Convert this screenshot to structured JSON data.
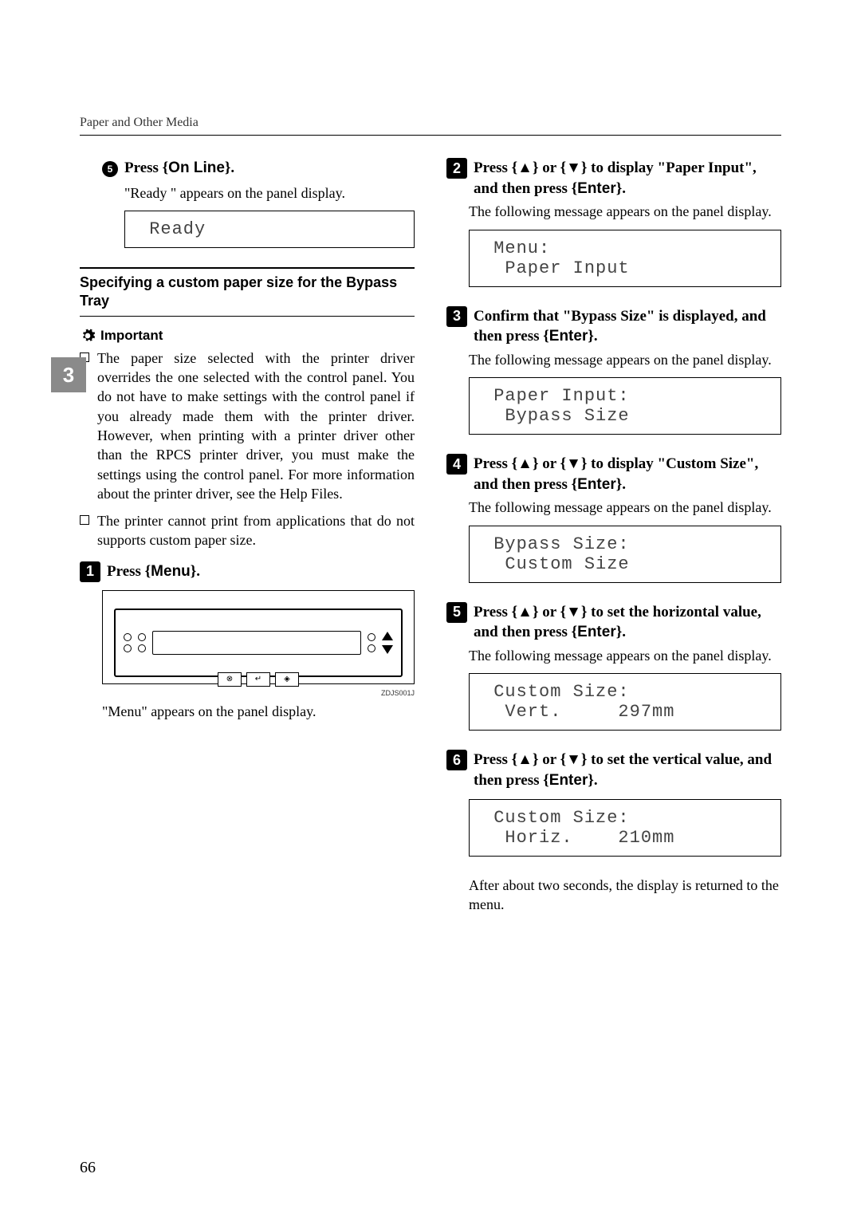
{
  "header": "Paper and Other Media",
  "side_tab": "3",
  "page_number": "66",
  "col1": {
    "step_e": {
      "num": "5",
      "prefix": "Press ",
      "key": "On Line",
      "suffix": "."
    },
    "step_e_body": "\"Ready \" appears on the panel display.",
    "lcd_ready": " Ready",
    "section_title": "Specifying a custom paper size for the Bypass Tray",
    "important_label": "Important",
    "bullet1": "The paper size selected with the printer driver overrides the one selected with the control panel. You do not have to make settings with the control panel if you already made them with the printer driver. However, when printing with a printer driver other than the RPCS printer driver, you must make the settings using the control panel. For more information about the printer driver, see the Help Files.",
    "bullet2": "The printer cannot print from applications that do not supports custom paper size.",
    "step1": {
      "num": "1",
      "prefix": "Press ",
      "key": "Menu",
      "suffix": "."
    },
    "panel_caption": "ZDJS001J",
    "step1_body": "\"Menu\" appears on the panel display."
  },
  "col2": {
    "step2": {
      "num": "2",
      "text_a": "Press ",
      "text_b": " or ",
      "text_c": " to display \"Paper Input\", and then press ",
      "key": "Enter",
      "suffix": "."
    },
    "msg_body": "The following message appears on the panel display.",
    "lcd_menu": " Menu:\n  Paper Input",
    "step3": {
      "num": "3",
      "text": "Confirm that \"Bypass Size\" is displayed, and then press ",
      "key": "Enter",
      "suffix": "."
    },
    "lcd_paper": " Paper Input:\n  Bypass Size",
    "step4": {
      "num": "4",
      "text_a": "Press ",
      "text_b": " or ",
      "text_c": " to display \"Custom Size\", and then press ",
      "key": "Enter",
      "suffix": "."
    },
    "lcd_bypass": " Bypass Size:\n  Custom Size",
    "step5": {
      "num": "5",
      "text_a": "Press ",
      "text_b": " or ",
      "text_c": " to set the horizontal value, and then press ",
      "key": "Enter",
      "suffix": "."
    },
    "lcd_custom_v": " Custom Size:\n  Vert.     297mm",
    "step6": {
      "num": "6",
      "text_a": "Press ",
      "text_b": " or ",
      "text_c": " to set the vertical value, and then press ",
      "key": "Enter",
      "suffix": "."
    },
    "lcd_custom_h": " Custom Size:\n  Horiz.    210mm",
    "after_body": "After about two seconds, the display is returned to the menu."
  }
}
